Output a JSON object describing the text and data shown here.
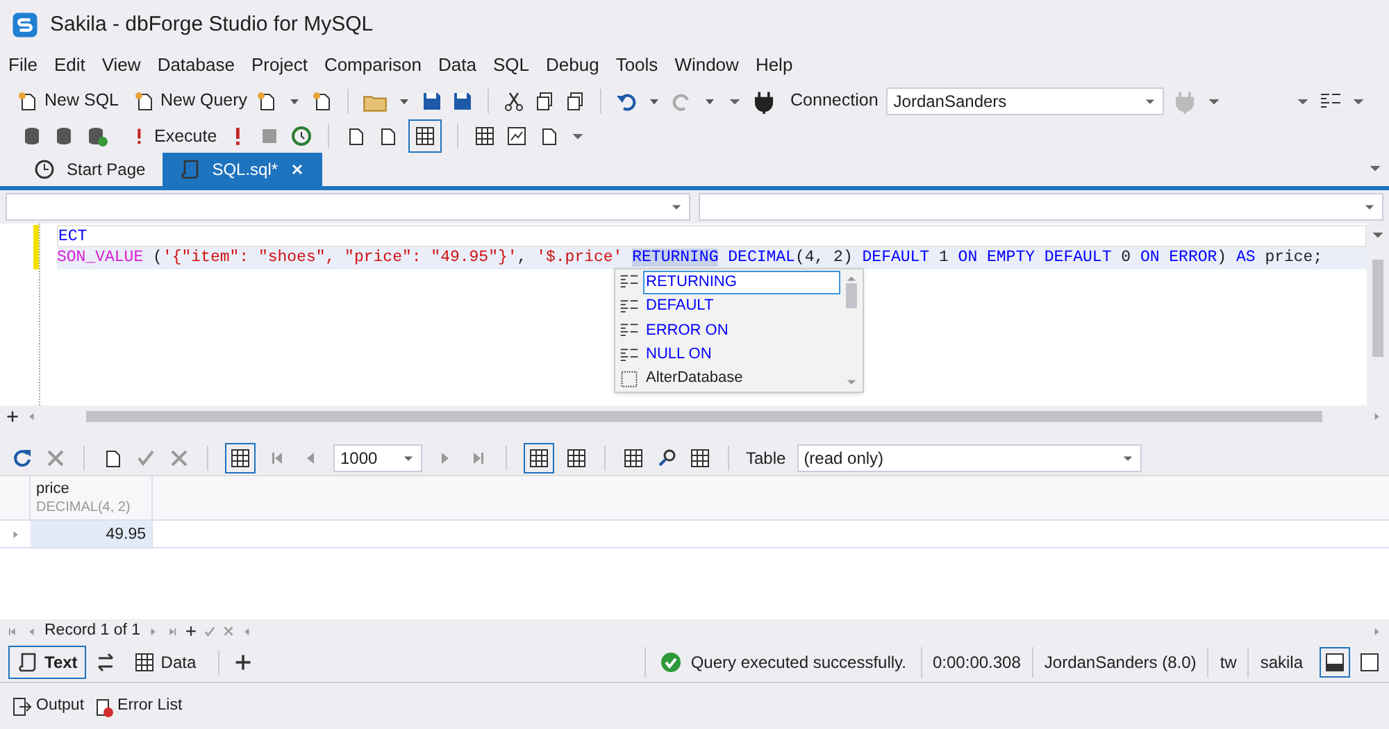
{
  "window": {
    "title": "Sakila - dbForge Studio for MySQL"
  },
  "menu": [
    "File",
    "Edit",
    "View",
    "Database",
    "Project",
    "Comparison",
    "Data",
    "SQL",
    "Debug",
    "Tools",
    "Window",
    "Help"
  ],
  "toolbar": {
    "new_sql": "New SQL",
    "new_query": "New Query",
    "connection_label": "Connection",
    "connection_value": "JordanSanders",
    "execute": "Execute"
  },
  "tabs": [
    {
      "label": "Start Page",
      "selected": false
    },
    {
      "label": "SQL.sql*",
      "selected": true
    }
  ],
  "editor": {
    "lines": [
      [
        {
          "kind": "keyword",
          "text": "ECT"
        }
      ],
      [
        {
          "kind": "function",
          "text": "SON_VALUE"
        },
        {
          "kind": "plain",
          "text": " ("
        },
        {
          "kind": "string",
          "text": "'{\"item\": \"shoes\", \"price\": \"49.95\"}'"
        },
        {
          "kind": "plain",
          "text": ", "
        },
        {
          "kind": "string",
          "text": "'$.price' "
        },
        {
          "kind": "highlight",
          "text": "RETURNING"
        },
        {
          "kind": "keyword",
          "text": " DECIMAL"
        },
        {
          "kind": "plain",
          "text": "(4, 2) "
        },
        {
          "kind": "keyword",
          "text": "DEFAULT "
        },
        {
          "kind": "plain",
          "text": "1 "
        },
        {
          "kind": "keyword",
          "text": "ON EMPTY DEFAULT "
        },
        {
          "kind": "plain",
          "text": "0 "
        },
        {
          "kind": "keyword",
          "text": "ON ERROR"
        },
        {
          "kind": "plain",
          "text": ") "
        },
        {
          "kind": "keyword",
          "text": "AS "
        },
        {
          "kind": "plain",
          "text": "price;"
        }
      ]
    ]
  },
  "autocomplete": [
    {
      "label": "RETURNING",
      "kind": "keyword",
      "selected": true
    },
    {
      "label": "DEFAULT",
      "kind": "keyword",
      "selected": false
    },
    {
      "label": "ERROR ON",
      "kind": "keyword",
      "selected": false
    },
    {
      "label": "NULL ON",
      "kind": "keyword",
      "selected": false
    },
    {
      "label": "AlterDatabase",
      "kind": "snippet",
      "selected": false
    }
  ],
  "results_toolbar": {
    "page_size": "1000",
    "table_label": "Table",
    "table_value": "(read only)"
  },
  "grid": {
    "columns": [
      {
        "name": "price",
        "type": "DECIMAL(4, 2)"
      }
    ],
    "rows": [
      [
        "49.95"
      ]
    ]
  },
  "record_nav": "Record 1 of 1",
  "view_tabs": [
    {
      "label": "Text",
      "selected": true
    },
    {
      "label": "Data",
      "selected": false
    }
  ],
  "status": {
    "message": "Query executed successfully.",
    "time": "0:00:00.308",
    "connection": "JordanSanders (8.0)",
    "user": "tw",
    "database": "sakila"
  },
  "bottom_tabs": [
    "Output",
    "Error List"
  ]
}
